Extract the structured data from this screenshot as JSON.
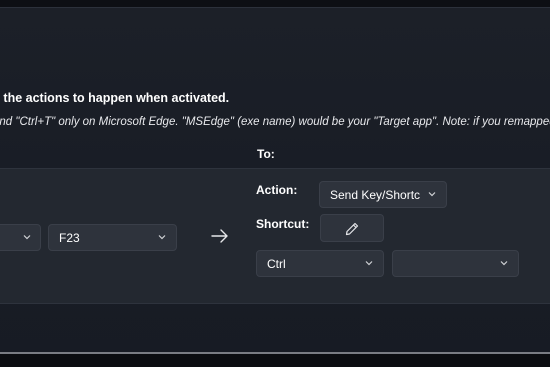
{
  "remap": {
    "heading": "e the actions to happen when activated.",
    "description": "end \"Ctrl+T\" only on Microsoft Edge. \"MSEdge\" (exe name) would be your \"Target app\". Note: if you remapped a key",
    "to_label": "To:",
    "from": {
      "first_key": "",
      "second_key": "F23"
    },
    "arrow_icon": "arrow-right-icon",
    "action_label": "Action:",
    "action_value": "Send Key/Shortcut",
    "shortcut_label": "Shortcut:",
    "edit_icon": "pencil-icon",
    "to": {
      "first_key": "Ctrl",
      "second_key": ""
    }
  }
}
